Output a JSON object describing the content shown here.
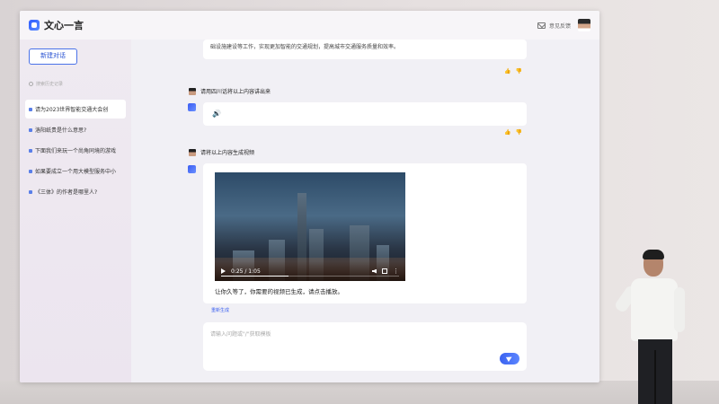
{
  "app": {
    "title": "文心一言",
    "feedback_label": "意见反馈"
  },
  "sidebar": {
    "new_chat_label": "新建对话",
    "search_placeholder": "搜索历史记录",
    "items": [
      {
        "label": "请为2023世界智能交通大会创"
      },
      {
        "label": "洛阳纸贵是什么意思?"
      },
      {
        "label": "下面我们来玩一个尚角同境的游戏"
      },
      {
        "label": "如果要成立一个用大模型服务中小"
      },
      {
        "label": "《三体》的作者是哪里人?"
      }
    ]
  },
  "chat": {
    "prev_answer_tail": "础设施建设等工作，实现更加智能的交通规划，提高城市交通服务质量和效率。",
    "q1": "请用四川话将以上内容讲出来",
    "q2": "请将以上内容生成视频",
    "video": {
      "time": "0:25 / 1:05",
      "progress": 0.38
    },
    "video_caption": "让你久等了，你需要的视频已生成，请点击播放。",
    "regenerate_label": "重新生成",
    "input_placeholder": "请输入问题或\"/\"获取模板"
  }
}
